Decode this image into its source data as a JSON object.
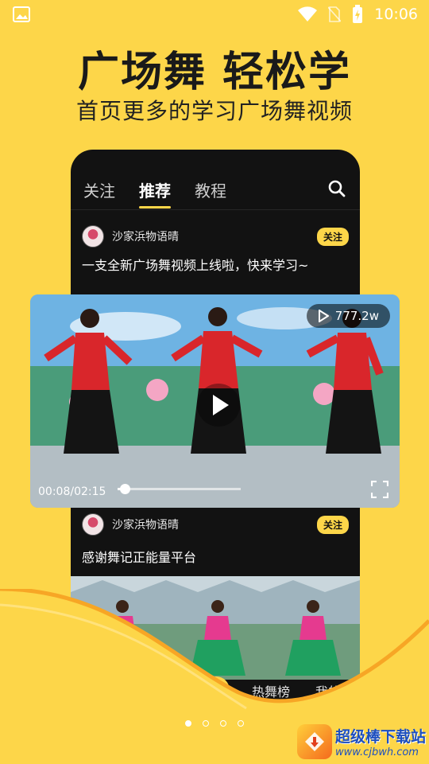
{
  "status_bar": {
    "time": "10:06"
  },
  "promo": {
    "headline": "广场舞 轻松学",
    "subline": "首页更多的学习广场舞视频"
  },
  "app": {
    "tabs": [
      {
        "label": "关注",
        "active": false
      },
      {
        "label": "推荐",
        "active": true
      },
      {
        "label": "教程",
        "active": false
      }
    ],
    "posts": [
      {
        "author": "沙家浜物语晴",
        "follow_label": "关注",
        "title": "一支全新广场舞视频上线啦，快来学习~"
      },
      {
        "author": "沙家浜物语晴",
        "follow_label": "关注",
        "title": "感谢舞记正能量平台"
      }
    ],
    "video": {
      "views": "777.2w",
      "current_time": "00:08",
      "duration": "02:15",
      "progress": 0.06
    },
    "bottom_nav": {
      "add_label": "+",
      "items": [
        "热舞榜",
        "我的"
      ]
    }
  },
  "pager": {
    "count": 4,
    "active_index": 0
  },
  "watermark": {
    "name": "超级棒下载站",
    "url": "www.cjbwh.com"
  },
  "colors": {
    "brand_yellow": "#FDD649",
    "phone_bg": "#121212",
    "dress_red": "#d9262b",
    "dress_pink": "#e53a8f"
  },
  "icons": [
    "image-icon",
    "wifi-icon",
    "no-sim-icon",
    "battery-icon",
    "search-icon",
    "play-icon",
    "fullscreen-icon"
  ]
}
